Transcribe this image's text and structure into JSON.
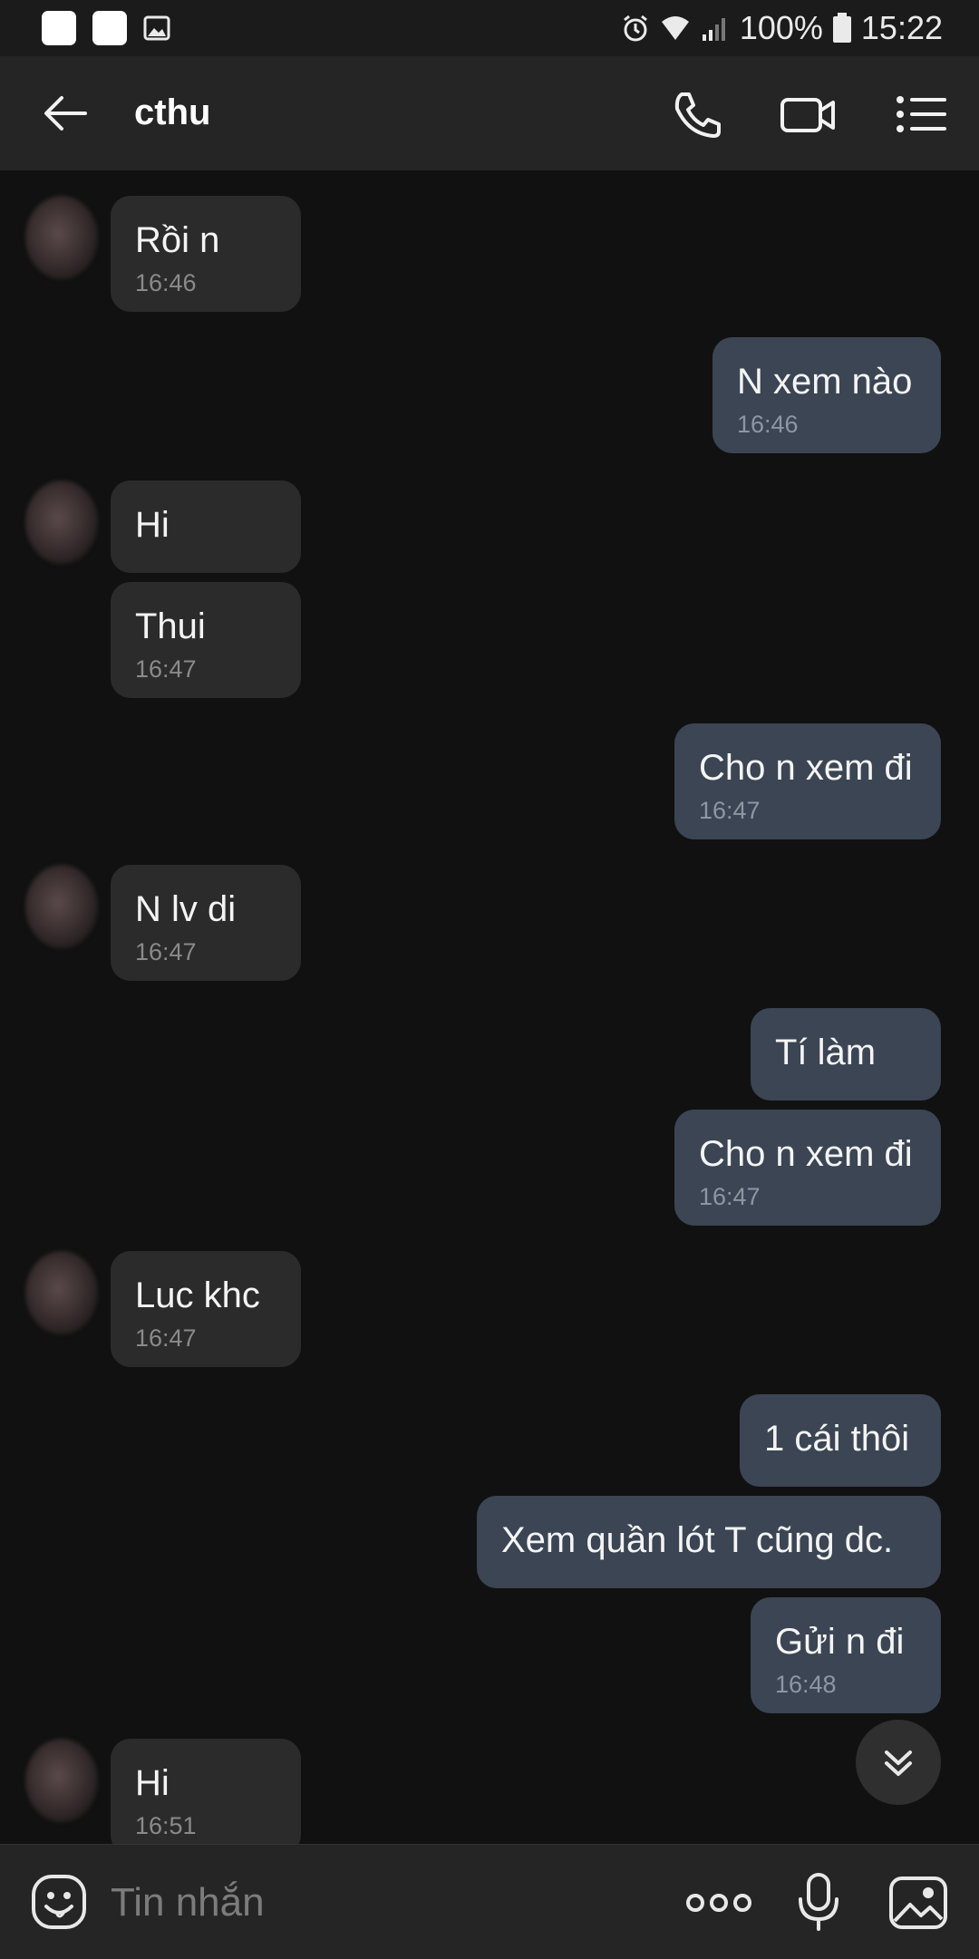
{
  "status_bar": {
    "battery": "100%",
    "time": "15:22",
    "icons": [
      "app-square-icon",
      "app-square-icon",
      "image-icon",
      "alarm-icon",
      "wifi-icon",
      "signal-icon",
      "battery-icon"
    ]
  },
  "header": {
    "title": "cthu",
    "icons": [
      "back-arrow-icon",
      "phone-icon",
      "video-camera-icon",
      "menu-list-icon"
    ]
  },
  "messages": [
    {
      "dir": "in",
      "text": "Rồi n",
      "time": "16:46"
    },
    {
      "dir": "out",
      "text": "N xem nào",
      "time": "16:46"
    },
    {
      "dir": "in",
      "text": "Hi",
      "time": ""
    },
    {
      "dir": "in",
      "text": "Thui",
      "time": "16:47"
    },
    {
      "dir": "out",
      "text": "Cho n xem đi",
      "time": "16:47"
    },
    {
      "dir": "in",
      "text": "N lv di",
      "time": "16:47"
    },
    {
      "dir": "out",
      "text": "Tí làm",
      "time": ""
    },
    {
      "dir": "out",
      "text": "Cho n xem đi",
      "time": "16:47"
    },
    {
      "dir": "in",
      "text": "Luc khc",
      "time": "16:47"
    },
    {
      "dir": "out",
      "text": "1 cái thôi",
      "time": ""
    },
    {
      "dir": "out",
      "text": "Xem quần lót T cũng dc.",
      "time": ""
    },
    {
      "dir": "out",
      "text": "Gửi n đi",
      "time": "16:48"
    },
    {
      "dir": "in",
      "text": "Hi",
      "time": "16:51"
    }
  ],
  "composer": {
    "placeholder": "Tin nhắn",
    "icons": [
      "emoji-icon",
      "more-options-icon",
      "microphone-icon",
      "gallery-icon"
    ]
  },
  "colors": {
    "background": "#111111",
    "header": "#252525",
    "incoming_bubble": "#2b2b2b",
    "outgoing_bubble": "#3b4553"
  }
}
